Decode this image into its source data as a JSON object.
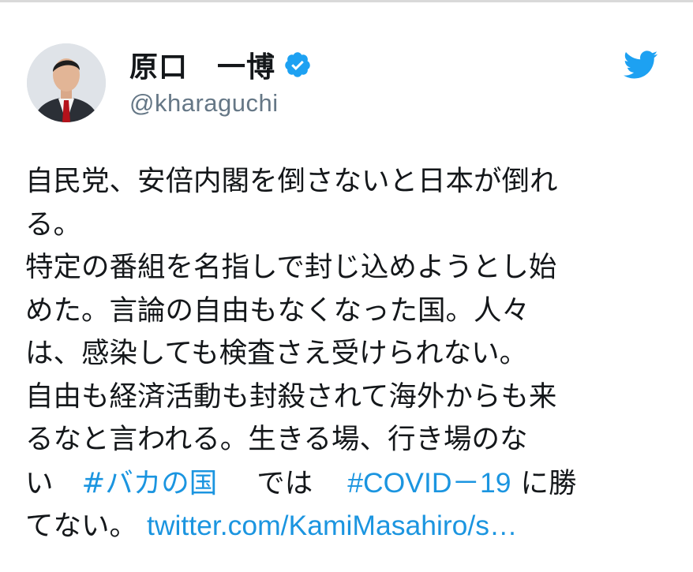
{
  "author": {
    "display_name": "原口　一博",
    "handle": "@kharaguchi",
    "verified": true
  },
  "icons": {
    "avatar": "avatar-photo",
    "verified": "verified-badge-icon",
    "platform": "twitter-bird-icon"
  },
  "colors": {
    "link": "#1b95e0",
    "verified": "#1da1f2",
    "handle": "#657786",
    "text": "#14171a"
  },
  "tweet": {
    "lines": [
      "自民党、安倍内閣を倒さないと日本が倒れ",
      "る。",
      "特定の番組を名指しで封じ込めようとし始",
      "めた。言論の自由もなくなった国。人々",
      "は、感染しても検査さえ受けられない。",
      "自由も経済活動も封殺されて海外からも来",
      "るなと言われる。生きる場、行き場のな"
    ],
    "line8_prefix": "い",
    "hashtag1": "#バカの国",
    "line8_middle": "では",
    "hashtag2": "#COVID－19",
    "line8_suffix": "に勝",
    "line9_prefix": "てない。",
    "link_text": "twitter.com/KamiMasahiro/s…"
  }
}
